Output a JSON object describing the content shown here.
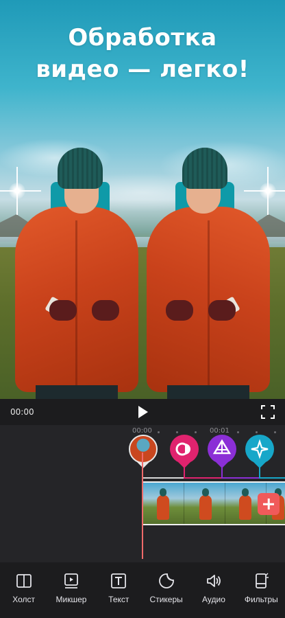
{
  "headline": {
    "line1": "Обработка",
    "line2": "видео — легко!"
  },
  "player": {
    "current_time": "00:00"
  },
  "timeline": {
    "ruler": [
      {
        "label": "00:00"
      },
      {
        "label": "00:01"
      }
    ],
    "effect_pins": [
      {
        "name": "transition-pin",
        "color": "#e0236e"
      },
      {
        "name": "effect-pin",
        "color": "#8b2fd6"
      },
      {
        "name": "filter-pin",
        "color": "#17a7c9"
      }
    ],
    "clip_count_visible": 4
  },
  "toolbar": {
    "items": [
      {
        "label": "Холст",
        "icon": "canvas-icon"
      },
      {
        "label": "Микшер",
        "icon": "mixer-icon"
      },
      {
        "label": "Текст",
        "icon": "text-icon"
      },
      {
        "label": "Стикеры",
        "icon": "sticker-icon"
      },
      {
        "label": "Аудио",
        "icon": "audio-icon"
      },
      {
        "label": "Фильтры",
        "icon": "filters-icon"
      }
    ]
  },
  "colors": {
    "accent": "#f06a6a",
    "background": "#1c1c1e",
    "timeline_bg": "#252528"
  }
}
